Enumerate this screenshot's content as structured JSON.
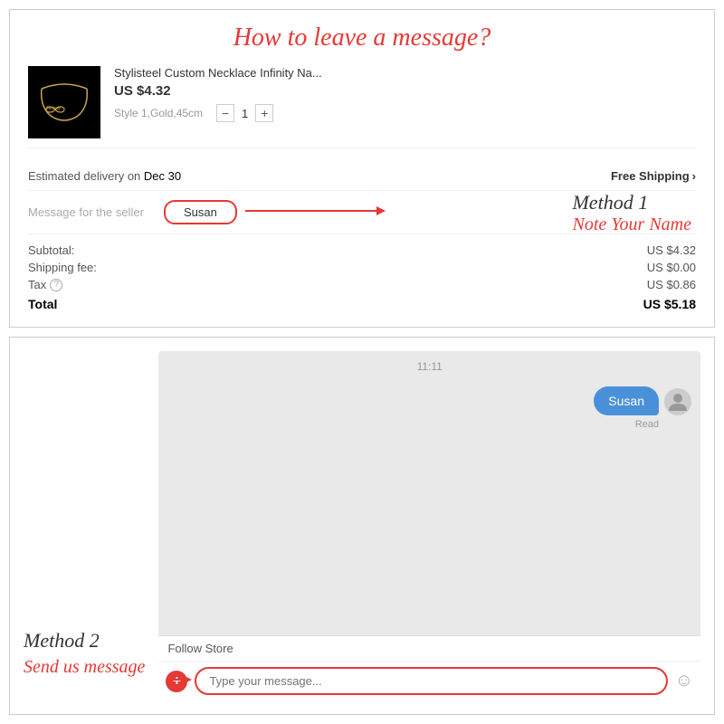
{
  "page": {
    "title": "How to leave a message?"
  },
  "method1": {
    "label": "Method 1",
    "sublabel": "Note Your Name"
  },
  "method2": {
    "label": "Method 2",
    "sublabel": "Send us message"
  },
  "product": {
    "name": "Stylisteel Custom Necklace Infinity Na...",
    "price": "US $4.32",
    "variant": "Style 1,Gold,45cm",
    "quantity": "1"
  },
  "delivery": {
    "label": "Estimated delivery on",
    "date": "Dec 30",
    "shipping": "Free Shipping",
    "chevron": "›"
  },
  "message_field": {
    "label": "Message for the seller",
    "value": "Susan"
  },
  "totals": {
    "subtotal_label": "Subtotal:",
    "subtotal_value": "US $4.32",
    "shipping_label": "Shipping fee:",
    "shipping_value": "US $0.00",
    "tax_label": "Tax",
    "tax_value": "US $0.86",
    "total_label": "Total",
    "total_value": "US $5.18"
  },
  "chat": {
    "time": "11:11",
    "bubble_text": "Susan",
    "read_label": "Read"
  },
  "chat_footer": {
    "follow_store": "Follow Store",
    "input_placeholder": "Type your message..."
  },
  "icons": {
    "plus": "+",
    "emoji": "☺",
    "chevron_right": "›",
    "info": "?"
  }
}
